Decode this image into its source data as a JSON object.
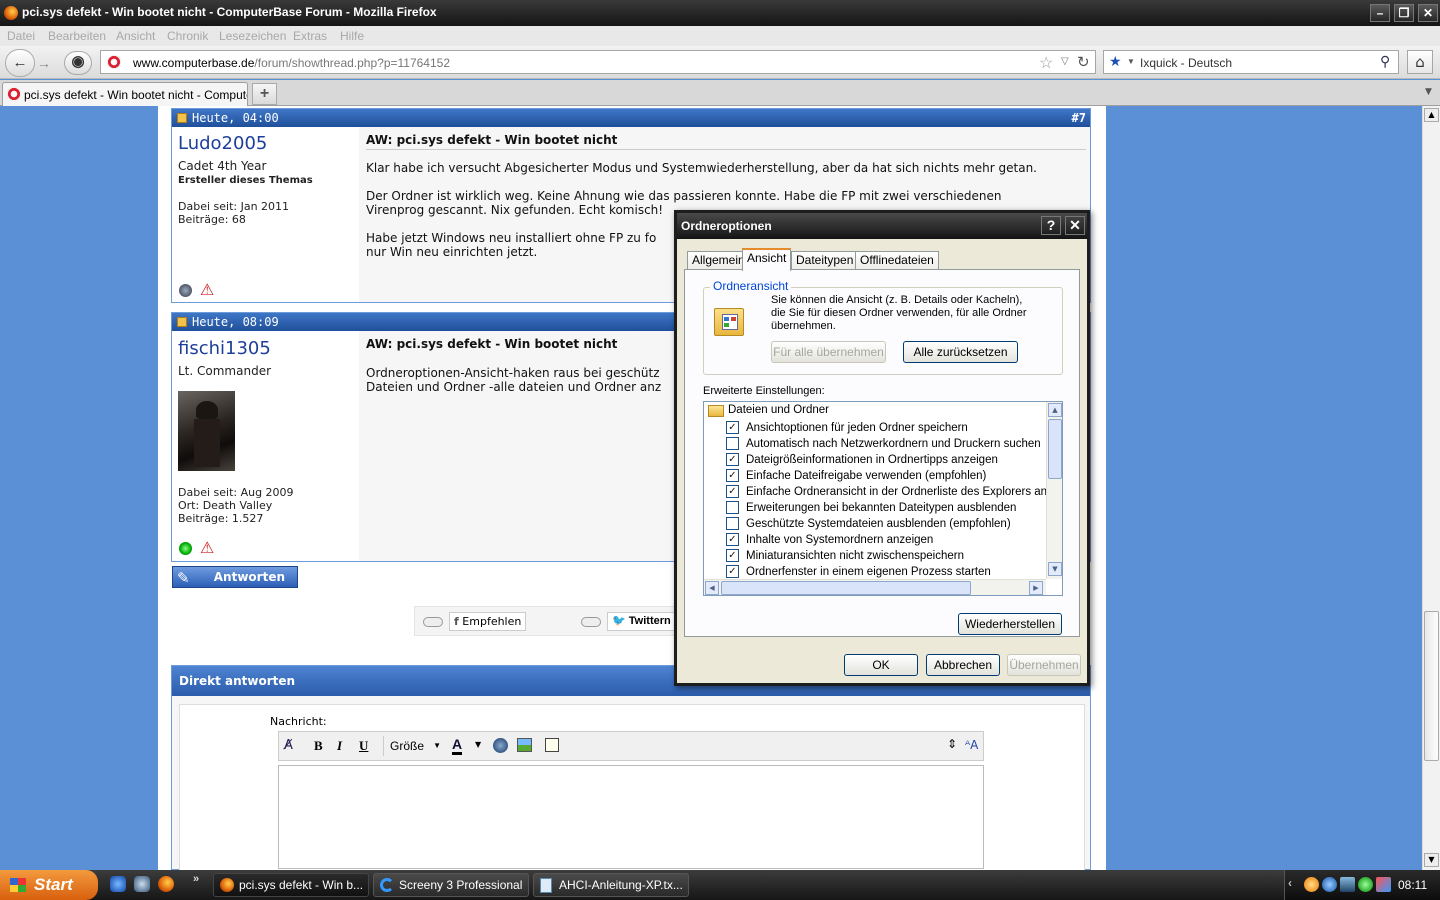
{
  "window": {
    "title": "pci.sys defekt - Win bootet nicht - ComputerBase Forum - Mozilla Firefox"
  },
  "menu": [
    "Datei",
    "Bearbeiten",
    "Ansicht",
    "Chronik",
    "Lesezeichen",
    "Extras",
    "Hilfe"
  ],
  "nav": {
    "url_domain": "www.computerbase.de",
    "url_path": "/forum/showthread.php?p=11764152",
    "search_engine": "Ixquick - Deutsch"
  },
  "tab": {
    "title": "pci.sys defekt - Win bootet nicht - ComputerB..."
  },
  "posts": [
    {
      "time": "Heute, 04:00",
      "number": "#7",
      "user": "Ludo2005",
      "rank": "Cadet 4th Year",
      "role": "Ersteller dieses Themas",
      "joined": "Dabei seit: Jan 2011",
      "location": "",
      "posts": "Beiträge: 68",
      "title": "AW: pci.sys defekt - Win bootet nicht",
      "body": [
        "Klar habe ich versucht Abgesicherter Modus und Systemwiederherstellung, aber da hat sich nichts mehr getan.",
        "Der Ordner ist wirklich weg. Keine Ahnung wie das passieren konnte. Habe die FP mit zwei verschiedenen",
        "Virenprog gescannt. Nix gefunden. Echt komisch!",
        "Habe jetzt Windows neu installiert ohne FP zu fo",
        "nur Win neu einrichten jetzt."
      ]
    },
    {
      "time": "Heute, 08:09",
      "number": "",
      "user": "fischi1305",
      "rank": "Lt. Commander",
      "role": "",
      "joined": "Dabei seit: Aug 2009",
      "location": "Ort: Death Valley",
      "posts": "Beiträge: 1.527",
      "title": "AW: pci.sys defekt - Win bootet nicht",
      "body": [
        "Ordneroptionen-Ansicht-haken raus bei geschütz",
        "Dateien und Ordner -alle dateien und Ordner anz"
      ]
    }
  ],
  "reply_button": "Antworten",
  "social": {
    "recommend": "Empfehlen",
    "tweet": "Twittern"
  },
  "quick_reply": {
    "header": "Direkt antworten",
    "label": "Nachricht:",
    "size_select": "Größe"
  },
  "dialog": {
    "title": "Ordneroptionen",
    "tabs": [
      "Allgemein",
      "Ansicht",
      "Dateitypen",
      "Offlinedateien"
    ],
    "active_tab": "Ansicht",
    "group_title": "Ordneransicht",
    "group_text": [
      "Sie können die Ansicht (z. B. Details oder Kacheln),",
      "die Sie für diesen Ordner verwenden, für alle Ordner",
      "übernehmen."
    ],
    "btn_apply_all": "Für alle übernehmen",
    "btn_reset_all": "Alle zurücksetzen",
    "advanced_label": "Erweiterte Einstellungen:",
    "folder_node": "Dateien und Ordner",
    "options": [
      {
        "label": "Ansichtoptionen für jeden Ordner speichern",
        "checked": true
      },
      {
        "label": "Automatisch nach Netzwerkordnern und Druckern suchen",
        "checked": false
      },
      {
        "label": "Dateigrößeinformationen in Ordnertipps anzeigen",
        "checked": true
      },
      {
        "label": "Einfache Dateifreigabe verwenden (empfohlen)",
        "checked": true
      },
      {
        "label": "Einfache Ordneransicht in der Ordnerliste des Explorers anzeige",
        "checked": true
      },
      {
        "label": "Erweiterungen bei bekannten Dateitypen ausblenden",
        "checked": false
      },
      {
        "label": "Geschützte Systemdateien ausblenden (empfohlen)",
        "checked": false
      },
      {
        "label": "Inhalte von Systemordnern anzeigen",
        "checked": true
      },
      {
        "label": "Miniaturansichten nicht zwischenspeichern",
        "checked": true
      },
      {
        "label": "Ordnerfenster in einem eigenen Prozess starten",
        "checked": true
      }
    ],
    "btn_restore": "Wiederherstellen",
    "btn_ok": "OK",
    "btn_cancel": "Abbrechen",
    "btn_apply": "Übernehmen"
  },
  "taskbar": {
    "start": "Start",
    "items": [
      "pci.sys defekt - Win b...",
      "Screeny 3 Professional",
      "AHCI-Anleitung-XP.tx..."
    ],
    "clock": "08:11"
  }
}
